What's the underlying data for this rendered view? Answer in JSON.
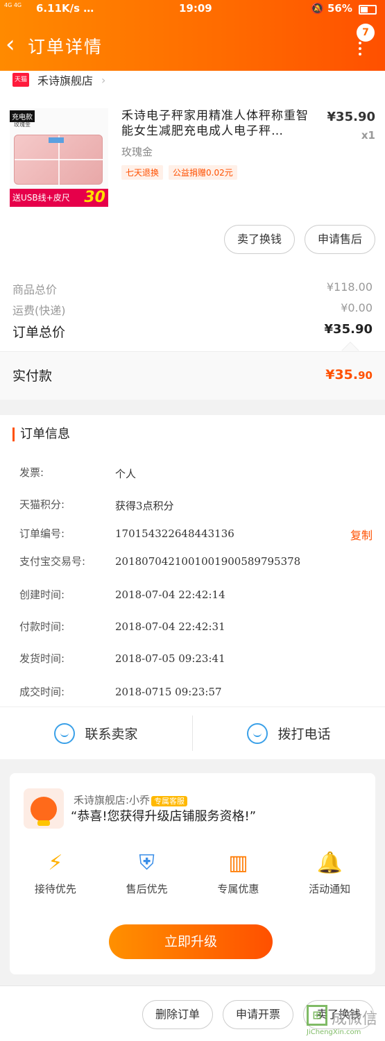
{
  "status_bar": {
    "network": "4G 4G",
    "speed": "6.11K/s …",
    "time": "19:09",
    "battery": "56%"
  },
  "header": {
    "title": "订单详情",
    "badge_count": "7"
  },
  "shop": {
    "tmall_label": "天猫",
    "name": "禾诗旗舰店"
  },
  "product": {
    "image_tags": {
      "charge": "充电款",
      "color": "玫瑰金",
      "promo": "送USB线+皮尺",
      "promo_num": "30"
    },
    "name": "禾诗电子秤家用精准人体秤称重智能女生减肥充电成人电子秤…",
    "spec": "玫瑰金",
    "tags": [
      "七天退换",
      "公益捐赠0.02元"
    ],
    "price": "¥35.90",
    "quantity": "x1"
  },
  "product_actions": [
    "卖了换钱",
    "申请售后"
  ],
  "summary": {
    "goods_label": "商品总价",
    "goods_value": "¥118.00",
    "shipping_label": "运费(快递)",
    "shipping_value": "¥0.00",
    "total_label": "订单总价",
    "total_value": "¥35.90"
  },
  "paid": {
    "label": "实付款",
    "value_main": "¥35.",
    "value_cents": "90"
  },
  "order_info": {
    "title": "订单信息",
    "rows": [
      {
        "key": "发票:",
        "value": "个人"
      },
      {
        "key": "天猫积分:",
        "value": "获得3点积分"
      },
      {
        "key": "订单编号:",
        "value": "170154322648443136"
      },
      {
        "key": "支付宝交易号:",
        "value": "2018070421001001900589795378"
      },
      {
        "key": "创建时间:",
        "value": "2018-07-04 22:42:14"
      },
      {
        "key": "付款时间:",
        "value": "2018-07-04 22:42:31"
      },
      {
        "key": "发货时间:",
        "value": "2018-07-05 09:23:41"
      },
      {
        "key": "成交时间:",
        "value": "2018-0715 09:23:57"
      }
    ],
    "copy_label": "复制"
  },
  "contact": {
    "seller": "联系卖家",
    "call": "拨打电话"
  },
  "upgrade": {
    "name": "禾诗旗舰店:小乔",
    "badge": "专属客服",
    "message": "“恭喜!您获得升级店铺服务资格!”",
    "perks": [
      {
        "icon": "lightning-icon",
        "label": "接待优先"
      },
      {
        "icon": "shield-icon",
        "label": "售后优先"
      },
      {
        "icon": "ticket-icon",
        "label": "专属优惠"
      },
      {
        "icon": "bell-icon",
        "label": "活动通知"
      }
    ],
    "button": "立即升级"
  },
  "bottom_actions": [
    "删除订单",
    "申请开票",
    "卖了换钱"
  ],
  "watermark": {
    "title": "成微信",
    "site": "JiChengXin.com"
  },
  "colors": {
    "accent": "#ff5000",
    "header": "#ff7a00",
    "link_blue": "#3aa0e8"
  }
}
